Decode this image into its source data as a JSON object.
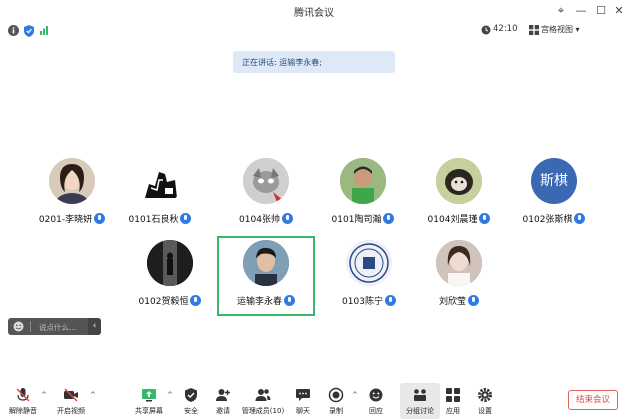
{
  "window": {
    "title": "腾讯会议"
  },
  "status": {
    "timer": "42:10",
    "view_mode": "宫格视图"
  },
  "speaking": {
    "text": "正在讲话: 运输李永春;"
  },
  "participants": [
    {
      "name": "0201-李晓妍",
      "bg": "#c9b7a5"
    },
    {
      "name": "0101石良秋",
      "bg": "#ffffff"
    },
    {
      "name": "0104张帅",
      "bg": "#d7d7d7"
    },
    {
      "name": "0101陶司瀚",
      "bg": "#7fae6b"
    },
    {
      "name": "0104刘晨瑾",
      "bg": "#b8c67e"
    },
    {
      "name": "0102张斯棋",
      "bg": "#3b68b3",
      "initials": "斯棋"
    },
    {
      "name": "0102贺毅恒",
      "bg": "#2b2b2b"
    },
    {
      "name": "运输李永春",
      "bg": "#6d8faa"
    },
    {
      "name": "0103陈宁",
      "bg": "#e8ecf3"
    },
    {
      "name": "刘欣莹",
      "bg": "#a98e80"
    }
  ],
  "chat": {
    "placeholder": "说点什么..."
  },
  "toolbar": {
    "mute": "解除静音",
    "video": "开启视频",
    "share": "共享屏幕",
    "security": "安全",
    "invite": "邀请",
    "members": "管理成员(10)",
    "chat": "聊天",
    "record": "录制",
    "reactions": "回应",
    "breakout": "分组讨论",
    "apps": "应用",
    "settings": "设置",
    "end": "结束会议"
  },
  "colors": {
    "accent": "#2f7ae5",
    "active_border": "#35b86a",
    "end": "#e04848"
  }
}
